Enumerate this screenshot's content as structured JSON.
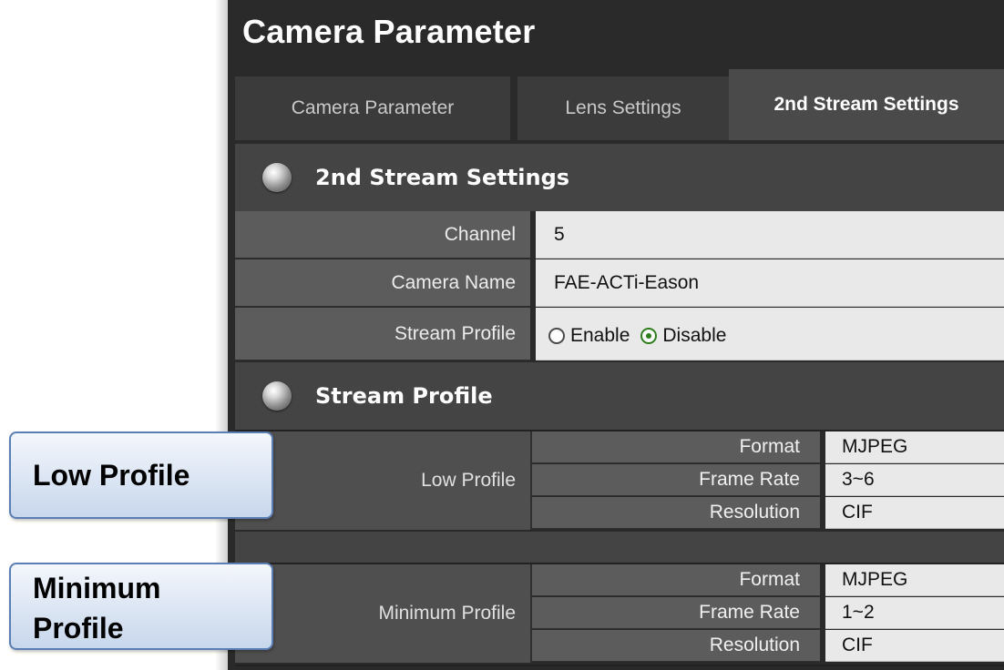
{
  "title": "Camera Parameter",
  "tabs": [
    {
      "label": "Camera Parameter",
      "active": false
    },
    {
      "label": "Lens Settings",
      "active": false
    },
    {
      "label": "2nd Stream Settings",
      "active": true
    }
  ],
  "stream_section": {
    "header": "2nd Stream Settings",
    "rows": [
      {
        "label": "Channel",
        "value": "5"
      },
      {
        "label": "Camera Name",
        "value": "FAE-ACTi-Eason"
      },
      {
        "label": "Stream Profile",
        "options": [
          "Enable",
          "Disable"
        ],
        "selected": "Disable"
      }
    ]
  },
  "profile_section": {
    "header": "Stream Profile",
    "profiles": [
      {
        "name": "Low Profile",
        "fields": [
          {
            "label": "Format",
            "value": "MJPEG"
          },
          {
            "label": "Frame Rate",
            "value": "3~6"
          },
          {
            "label": "Resolution",
            "value": "CIF"
          }
        ]
      },
      {
        "name": "Minimum Profile",
        "fields": [
          {
            "label": "Format",
            "value": "MJPEG"
          },
          {
            "label": "Frame Rate",
            "value": "1~2"
          },
          {
            "label": "Resolution",
            "value": "CIF"
          }
        ]
      }
    ]
  },
  "callouts": {
    "low": "Low Profile",
    "minimum_line1": "Minimum",
    "minimum_line2": "Profile"
  },
  "colors": {
    "panel_bg": "#2a2a2a",
    "value_bg": "#e9e9e9",
    "radio_selected": "#2e7d1d",
    "callout_border": "#5b7fb5"
  }
}
